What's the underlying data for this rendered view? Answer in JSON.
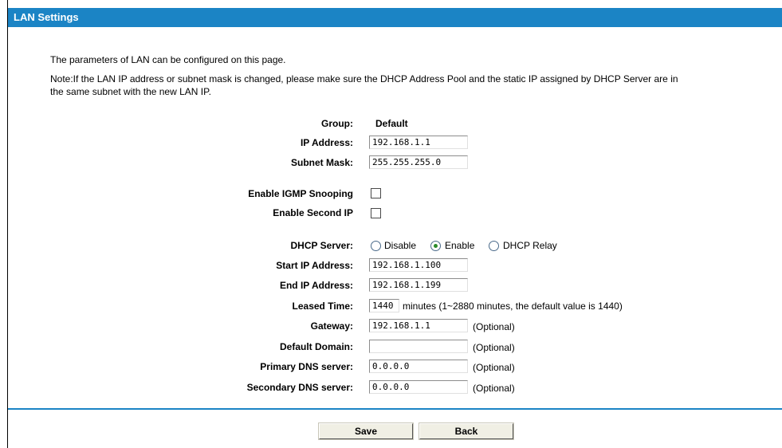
{
  "header": {
    "title": "LAN Settings"
  },
  "intro": {
    "line1": "The parameters of LAN can be configured on this page.",
    "line2": "Note:If the LAN IP address or subnet mask is changed, please make sure the DHCP Address Pool and the static IP assigned by DHCP Server are in",
    "line3": "the same subnet with the new LAN IP."
  },
  "form": {
    "group_label": "Group:",
    "group_value": "Default",
    "ip_label": "IP Address:",
    "ip_value": "192.168.1.1",
    "mask_label": "Subnet Mask:",
    "mask_value": "255.255.255.0",
    "igmp_label": "Enable IGMP Snooping",
    "igmp_checked": false,
    "second_ip_label": "Enable Second IP",
    "second_ip_checked": false,
    "dhcp_label": "DHCP Server:",
    "dhcp_options": [
      "Disable",
      "Enable",
      "DHCP Relay"
    ],
    "dhcp_selected": "Enable",
    "start_label": "Start IP Address:",
    "start_value": "192.168.1.100",
    "end_label": "End IP Address:",
    "end_value": "192.168.1.199",
    "lease_label": "Leased Time:",
    "lease_value": "1440",
    "lease_hint": "minutes (1~2880 minutes, the default value is 1440)",
    "gateway_label": "Gateway:",
    "gateway_value": "192.168.1.1",
    "domain_label": "Default Domain:",
    "domain_value": "",
    "pdns_label": "Primary DNS server:",
    "pdns_value": "0.0.0.0",
    "sdns_label": "Secondary DNS server:",
    "sdns_value": "0.0.0.0",
    "optional_text": "(Optional)"
  },
  "buttons": {
    "save": "Save",
    "back": "Back"
  },
  "colors": {
    "header_bg": "#1b84c5",
    "rule": "#1b84c5"
  }
}
